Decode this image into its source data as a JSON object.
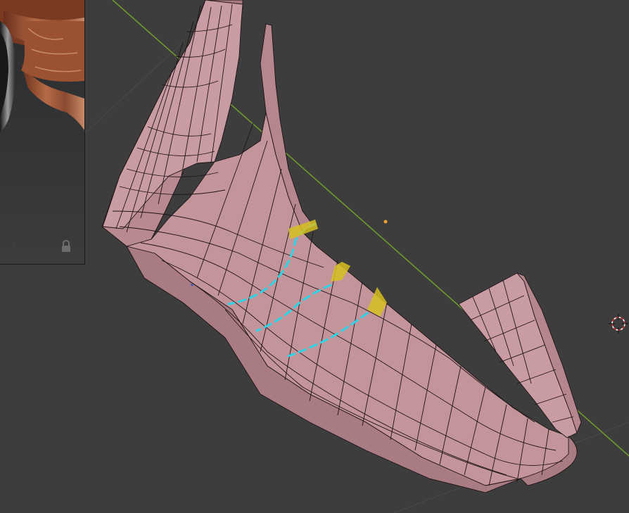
{
  "viewport": {
    "background": "#3d3d3d",
    "mesh_color": "#c4949b",
    "wire_color": "#1f1416",
    "axis_line_color": "#6f9a2c",
    "guide_line_color": "#2bd4e6",
    "marker_color": "#d7c020"
  },
  "reference_image": {
    "icon": "lock-icon"
  },
  "cursor": {
    "icon": "3d-cursor-icon"
  }
}
